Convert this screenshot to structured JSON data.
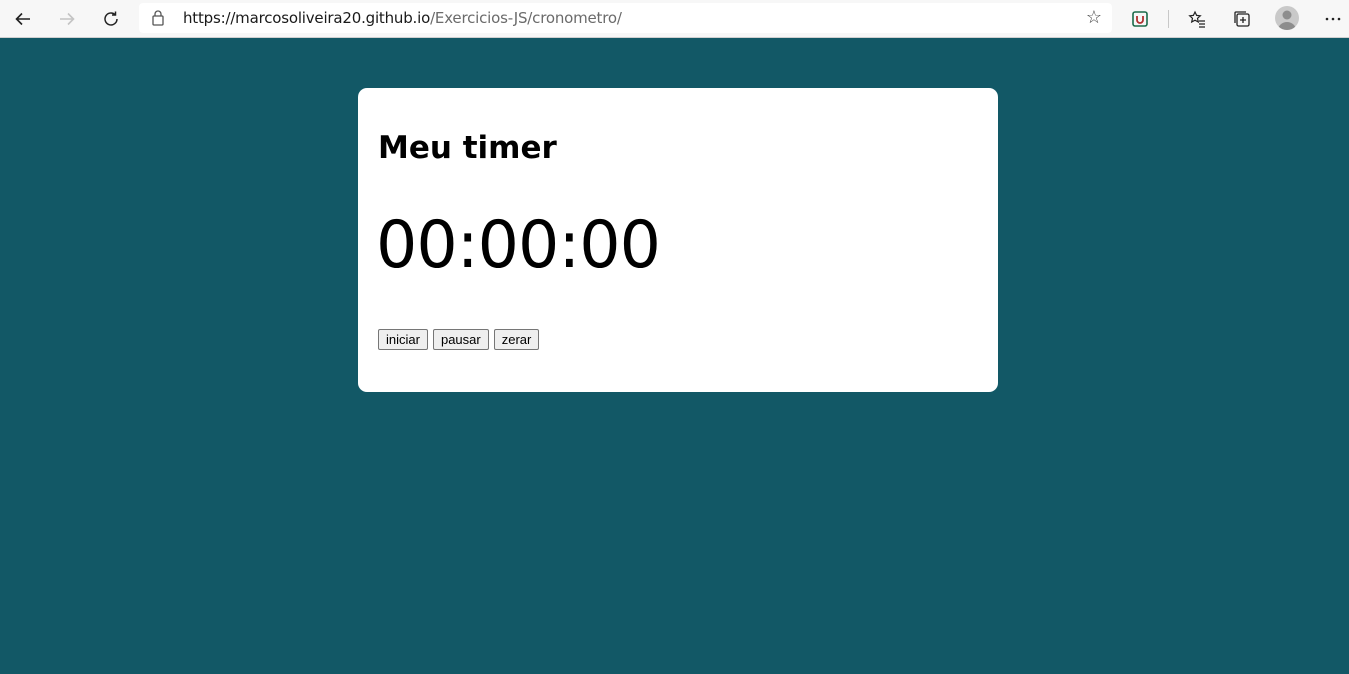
{
  "browser": {
    "url_host": "https://marcosoliveira20.github.io",
    "url_path": "/Exercicios-JS/cronometro/",
    "icons": [
      "back-icon",
      "forward-icon",
      "refresh-icon",
      "lock-icon",
      "favorite-star-icon",
      "extension-icon",
      "favorites-icon",
      "collections-icon",
      "profile-icon",
      "more-icon"
    ]
  },
  "timer": {
    "title": "Meu timer",
    "display": "00:00:00",
    "buttons": {
      "start": "iniciar",
      "pause": "pausar",
      "reset": "zerar"
    }
  },
  "colors": {
    "background": "#125866",
    "card": "#ffffff"
  }
}
